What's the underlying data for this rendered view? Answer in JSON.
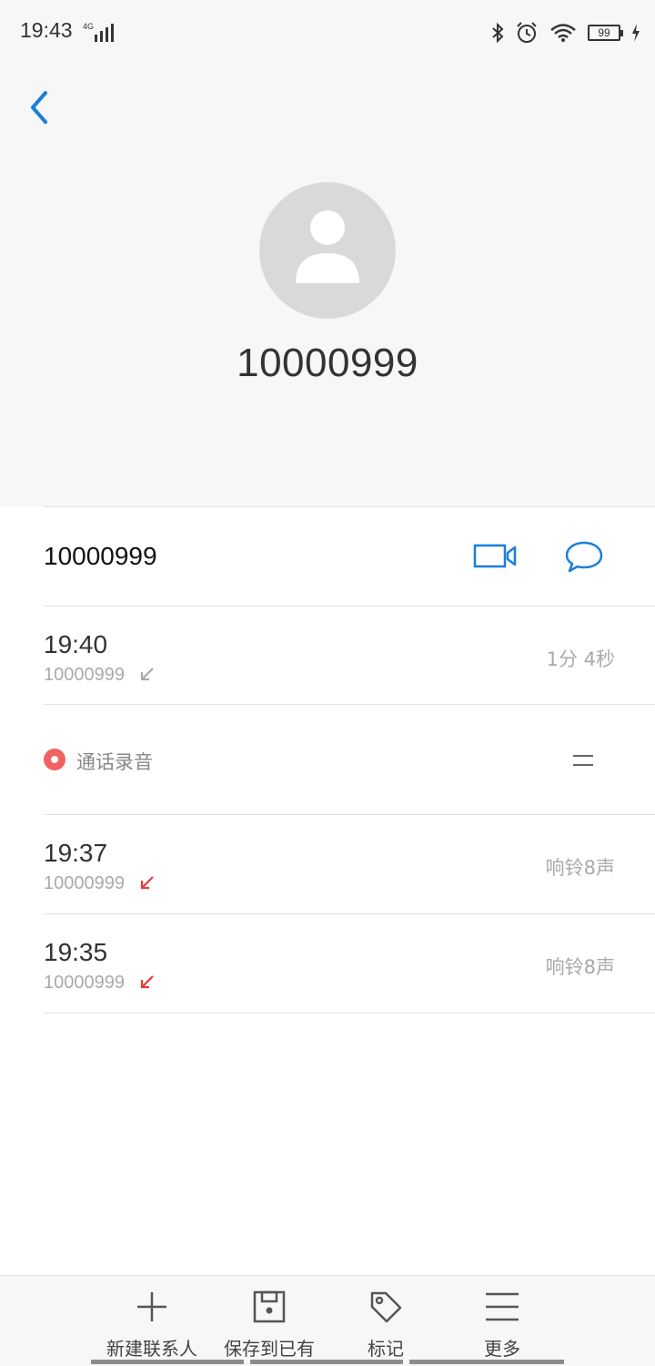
{
  "status_bar": {
    "time": "19:43",
    "network": "4G",
    "battery": "99"
  },
  "contact": {
    "name": "10000999",
    "phone": "10000999"
  },
  "colors": {
    "accent": "#1a7fd9",
    "missed": "#e23b3b",
    "record": "#f06262"
  },
  "calls": [
    {
      "time": "19:40",
      "number": "10000999",
      "detail": "1分 4秒",
      "type": "incoming"
    },
    {
      "time": "19:37",
      "number": "10000999",
      "detail": "响铃8声",
      "type": "missed"
    },
    {
      "time": "19:35",
      "number": "10000999",
      "detail": "响铃8声",
      "type": "missed"
    }
  ],
  "recording": {
    "label": "通话录音"
  },
  "bottom_bar": {
    "new_contact": "新建联系人",
    "save_existing": "保存到已有",
    "mark": "标记",
    "more": "更多"
  }
}
